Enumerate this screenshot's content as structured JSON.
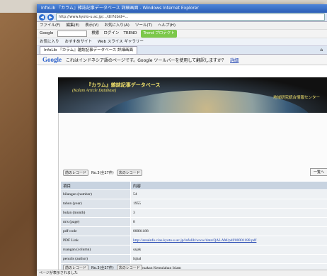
{
  "window": {
    "title": "InfoLib 『カラム』雑誌記事データベース 詳細画面 - Windows Internet Explorer"
  },
  "address": {
    "url": "http://www.kyoto-u.ac.jp/.../dtl?dbid=...",
    "nav_back": "◀",
    "nav_fwd": "▶"
  },
  "menu": [
    "ファイル(F)",
    "編集(E)",
    "表示(V)",
    "お気に入り(A)",
    "ツール(T)",
    "ヘルプ(H)"
  ],
  "toolbar": {
    "google": "Google",
    "search": "検索",
    "login": "ログイン",
    "trend": "TREND",
    "trend_btn": "Trend プロテクト"
  },
  "favorites": [
    "お気に入り",
    "おすすめサイト",
    "Web スライス ギャラリー"
  ],
  "tab": {
    "label": "InfoLib 『カラム』雑誌記事データベース 詳細画面"
  },
  "gbar": {
    "logo": "Google",
    "message": "これはインドネシア語のページです。Google ツールバーを使用して翻訳しますか？",
    "link": "詳細"
  },
  "banner": {
    "title": "『カラム』雑誌記事データベース",
    "subtitle": "(Kalam Article Database)",
    "org": "地域研究統合情報センター"
  },
  "pager_top": {
    "prev": "前のレコード",
    "count": "No.3(全27件)",
    "next": "次のレコード"
  },
  "pager_bottom": {
    "prev": "前のレコード",
    "count": "No.3(全27件)",
    "next": "次のレコード"
  },
  "next_btn": "一覧へ",
  "table": {
    "headers": [
      "項目",
      "内容"
    ],
    "rows": [
      {
        "field": "bilangan (number)",
        "value": "54"
      },
      {
        "field": "tahun (year)",
        "value": "1955"
      },
      {
        "field": "bulan (month)",
        "value": "3"
      },
      {
        "field": "m/s (page)",
        "value": "8"
      },
      {
        "field": "pdf-code",
        "value": "00001188"
      },
      {
        "field": "PDF Link",
        "value": "http://areainfo.cias.kyoto-u.ac.jp/infolib/www/data/QALAM/pdf/00001188.pdf"
      },
      {
        "field": "ruangan (column)",
        "value": "sajak"
      },
      {
        "field": "penulis (author)",
        "value": "Iqbal"
      },
      {
        "field": "tajuk (article)",
        "value": "Membuakan Kemulahan Islam"
      }
    ]
  },
  "status": "ページが表示されました"
}
